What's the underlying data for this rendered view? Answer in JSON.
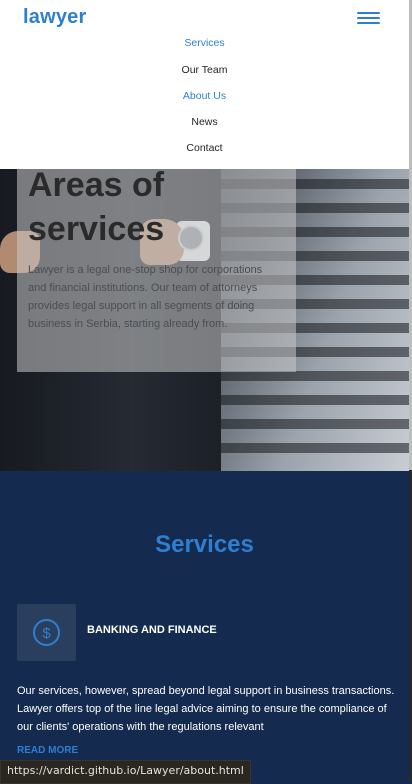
{
  "header": {
    "logo": "lawyer",
    "nav": [
      {
        "label": "Services",
        "active": true
      },
      {
        "label": "Our Team",
        "active": false
      },
      {
        "label": "About Us",
        "active": true
      },
      {
        "label": "News",
        "active": false
      },
      {
        "label": "Contact",
        "active": false
      }
    ]
  },
  "hero": {
    "title": "Areas of services",
    "text": "Lawyer is a legal one-stop shop for corporations and financial institutions. Our team of attorneys provides legal support in all segments of doing business in Serbia, starting already from."
  },
  "services": {
    "title": "Services",
    "items": [
      {
        "name": "BANKING AND FINANCE",
        "icon": "dollar-circle-icon",
        "description": "Our services, however, spread beyond legal support in business transactions. Lawyer offers top of the line legal advice aiming to ensure the compliance of our clients' operations with the regulations relevant",
        "link": "READ MORE"
      }
    ]
  },
  "status_url": "https://vardict.github.io/Lawyer/about.html",
  "colors": {
    "accent": "#2f7fd1",
    "dark_bg": "#142a4f"
  }
}
